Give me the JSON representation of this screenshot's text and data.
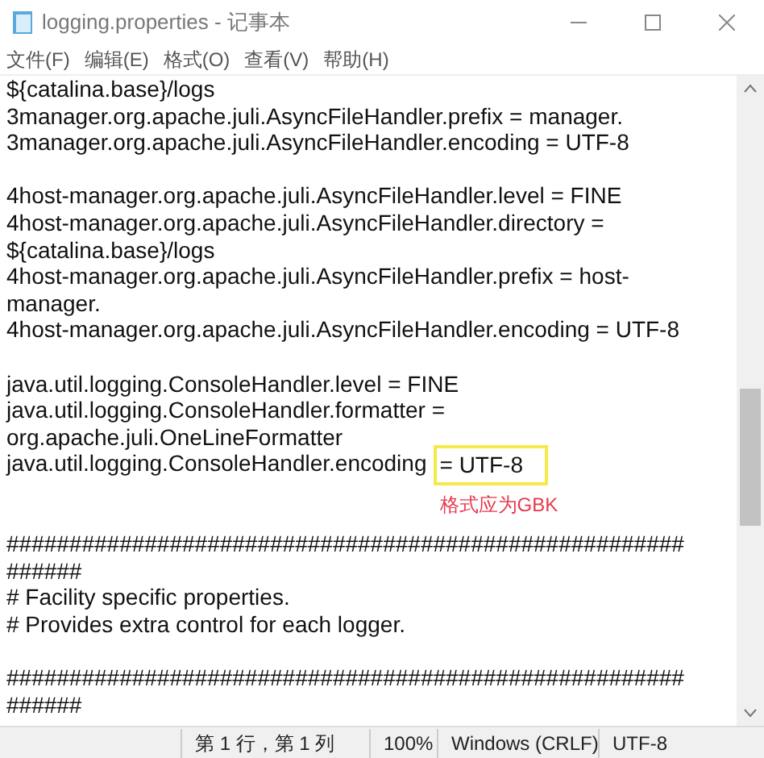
{
  "window": {
    "title": "logging.properties - 记事本"
  },
  "menu": [
    "文件(F)",
    "编辑(E)",
    "格式(O)",
    "查看(V)",
    "帮助(H)"
  ],
  "paragraphs": [
    {
      "lines": [
        {
          "text": "${catalina.base}/logs"
        },
        {
          "text": "3manager.org.apache.juli.AsyncFileHandler.prefix = manager."
        },
        {
          "text": "3manager.org.apache.juli.AsyncFileHandler.encoding = UTF-8"
        }
      ]
    },
    {
      "lines": [
        {
          "text": "4host-manager.org.apache.juli.AsyncFileHandler.level = FINE"
        },
        {
          "text": "4host-manager.org.apache.juli.AsyncFileHandler.directory ="
        },
        {
          "text": "${catalina.base}/logs"
        },
        {
          "text": "4host-manager.org.apache.juli.AsyncFileHandler.prefix = host-"
        },
        {
          "text": "manager."
        },
        {
          "text": "4host-manager.org.apache.juli.AsyncFileHandler.encoding = UTF-8"
        }
      ]
    },
    {
      "lines": [
        {
          "text": "java.util.logging.ConsoleHandler.level = FINE"
        },
        {
          "text": "java.util.logging.ConsoleHandler.formatter ="
        },
        {
          "text": "org.apache.juli.OneLineFormatter"
        },
        {
          "text": "java.util.logging.ConsoleHandler.encoding",
          "highlight": "= UTF-8",
          "note": "格式应为GBK"
        }
      ]
    },
    {
      "lines": [
        {
          "text": "######################################################"
        },
        {
          "text": "######"
        },
        {
          "text": "# Facility specific properties."
        },
        {
          "text": "# Provides extra control for each logger."
        }
      ]
    },
    {
      "lines": [
        {
          "text": "######################################################"
        },
        {
          "text": "######"
        }
      ]
    }
  ],
  "status_bar": [
    "第 1 行，第 1 列",
    "100%",
    "Windows (CRLF)",
    "UTF-8"
  ]
}
